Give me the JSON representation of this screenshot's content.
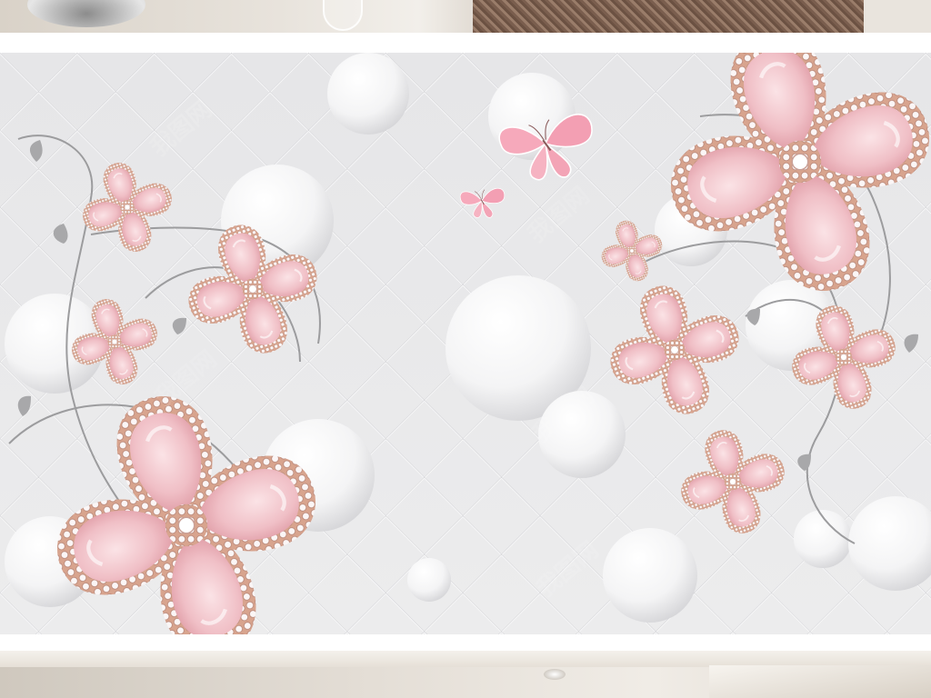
{
  "scene": {
    "description_tag": "jewel-flower-3d-wallpaper",
    "watermark_glyph": "我图网",
    "colors": {
      "background": "#e9e9ea",
      "tile_highlight": "#f6f6f7",
      "tile_shadow": "#cfcfd1",
      "sphere": "#ffffff",
      "petal": "#f0c6cb",
      "petal_deep": "#d98f99",
      "rose_gold": "#d9a08a",
      "diamond": "#fbf7f7",
      "stem": "#9a9a9a",
      "butterfly": "#f39fb3"
    }
  }
}
